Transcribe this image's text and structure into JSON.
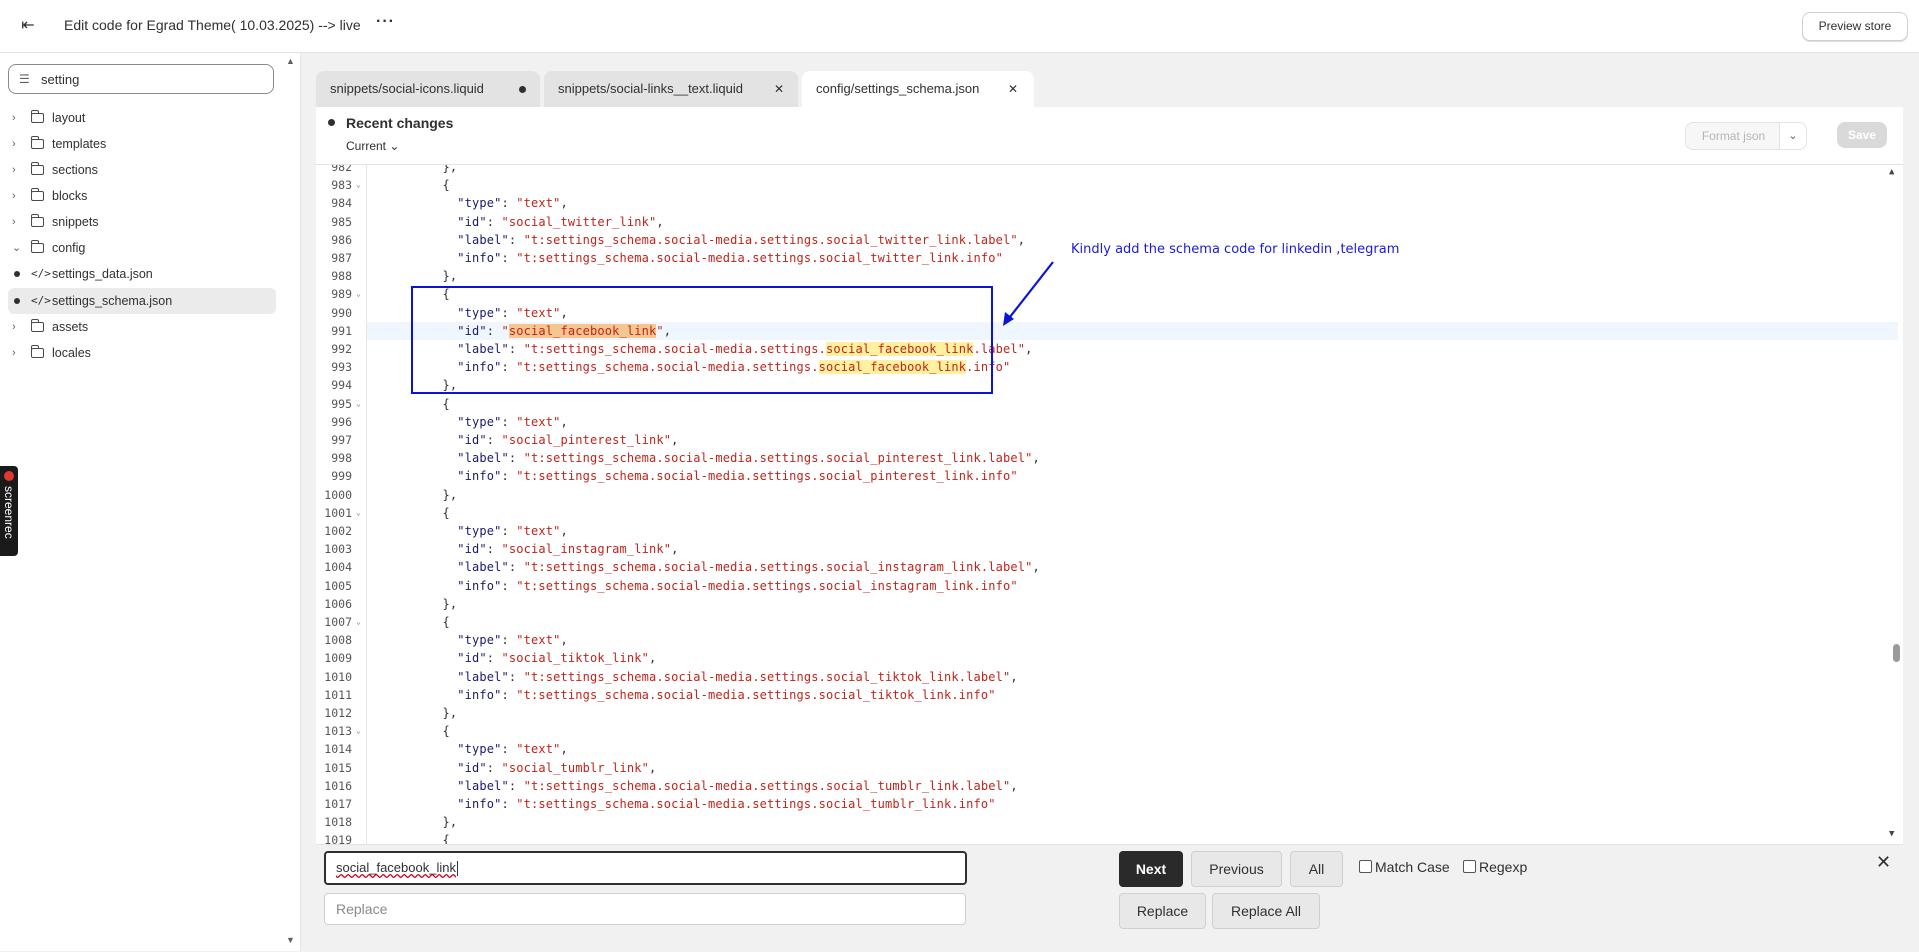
{
  "header": {
    "back_icon": "exit-icon",
    "title": "Edit code for Egrad Theme( 10.03.2025) --> live",
    "more_label": "···",
    "preview_label": "Preview store"
  },
  "sidebar": {
    "filter_value": "setting",
    "items": [
      {
        "type": "folder",
        "label": "layout"
      },
      {
        "type": "folder",
        "label": "templates"
      },
      {
        "type": "folder",
        "label": "sections"
      },
      {
        "type": "folder",
        "label": "blocks"
      },
      {
        "type": "folder",
        "label": "snippets"
      },
      {
        "type": "folder",
        "label": "config"
      },
      {
        "type": "file",
        "label": "settings_data.json"
      },
      {
        "type": "file",
        "label": "settings_schema.json"
      },
      {
        "type": "folder",
        "label": "assets"
      },
      {
        "type": "folder",
        "label": "locales"
      }
    ],
    "screenrec_label": "screenrec"
  },
  "tabs": [
    {
      "prefix": "",
      "name": "snippets/social-icons.liquid",
      "state": "unsaved"
    },
    {
      "prefix": "",
      "name": "snippets/social-links__text.liquid",
      "state": "close"
    },
    {
      "prefix": "config/",
      "name": "settings_schema.json",
      "state": "close"
    }
  ],
  "editor": {
    "recent_changes": "Recent changes",
    "current_label": "Current",
    "format_label": "Format json",
    "save_label": "Save",
    "current_line_number": 991
  },
  "code": {
    "first_line": 982,
    "lines": [
      "    },",
      "    {",
      "      \"type\": \"text\",",
      "      \"id\": \"social_twitter_link\",",
      "      \"label\": \"t:settings_schema.social-media.settings.social_twitter_link.label\",",
      "      \"info\": \"t:settings_schema.social-media.settings.social_twitter_link.info\"",
      "    },",
      "    {",
      "      \"type\": \"text\",",
      "      \"id\": \"social_facebook_link\",",
      "      \"label\": \"t:settings_schema.social-media.settings.social_facebook_link.label\",",
      "      \"info\": \"t:settings_schema.social-media.settings.social_facebook_link.info\"",
      "    },",
      "    {",
      "      \"type\": \"text\",",
      "      \"id\": \"social_pinterest_link\",",
      "      \"label\": \"t:settings_schema.social-media.settings.social_pinterest_link.label\",",
      "      \"info\": \"t:settings_schema.social-media.settings.social_pinterest_link.info\"",
      "    },",
      "    {",
      "      \"type\": \"text\",",
      "      \"id\": \"social_instagram_link\",",
      "      \"label\": \"t:settings_schema.social-media.settings.social_instagram_link.label\",",
      "      \"info\": \"t:settings_schema.social-media.settings.social_instagram_link.info\"",
      "    },",
      "    {",
      "      \"type\": \"text\",",
      "      \"id\": \"social_tiktok_link\",",
      "      \"label\": \"t:settings_schema.social-media.settings.social_tiktok_link.label\",",
      "      \"info\": \"t:settings_schema.social-media.settings.social_tiktok_link.info\"",
      "    },",
      "    {",
      "      \"type\": \"text\",",
      "      \"id\": \"social_tumblr_link\",",
      "      \"label\": \"t:settings_schema.social-media.settings.social_tumblr_link.label\",",
      "      \"info\": \"t:settings_schema.social-media.settings.social_tumblr_link.info\"",
      "    },",
      "    {"
    ],
    "fold_lines": [
      983,
      989,
      995,
      1001,
      1007,
      1013
    ],
    "search_term": "social_facebook_link"
  },
  "annotation": {
    "text": "Kindly add the schema code for linkedin ,telegram",
    "color": "#0a14d6"
  },
  "find": {
    "value": "social_facebook_link",
    "replace_placeholder": "Replace",
    "next_label": "Next",
    "previous_label": "Previous",
    "all_label": "All",
    "match_case_label": "Match Case",
    "regexp_label": "Regexp",
    "replace_label": "Replace",
    "replace_all_label": "Replace All"
  }
}
